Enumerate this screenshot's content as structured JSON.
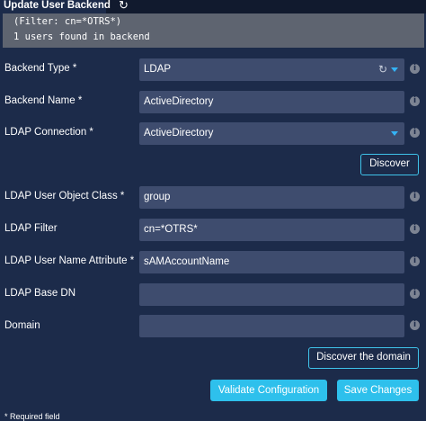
{
  "window": {
    "tab_title": "Update User Backend",
    "refresh_icon": "refresh-icon"
  },
  "console": {
    "lines": [
      "(Filter: cn=*OTRS*)",
      "1 users found in backend"
    ]
  },
  "form": {
    "backend_type": {
      "label": "Backend Type *",
      "value": "LDAP"
    },
    "backend_name": {
      "label": "Backend Name *",
      "value": "ActiveDirectory"
    },
    "ldap_connection": {
      "label": "LDAP Connection *",
      "value": "ActiveDirectory"
    },
    "discover_label": "Discover",
    "object_class": {
      "label": "LDAP User Object Class *",
      "value": "group"
    },
    "ldap_filter": {
      "label": "LDAP Filter",
      "value": "cn=*OTRS*"
    },
    "username_attr": {
      "label": "LDAP User Name Attribute *",
      "value": "sAMAccountName"
    },
    "base_dn": {
      "label": "LDAP Base DN",
      "value": ""
    },
    "domain": {
      "label": "Domain",
      "value": ""
    },
    "discover_domain_label": "Discover the domain"
  },
  "actions": {
    "validate_label": "Validate Configuration",
    "save_label": "Save Changes"
  },
  "footnote": "* Required field",
  "colors": {
    "background": "#1c2b4a",
    "field": "#3e4c6e",
    "accent": "#2ec0ec",
    "console": "#5e6470"
  }
}
